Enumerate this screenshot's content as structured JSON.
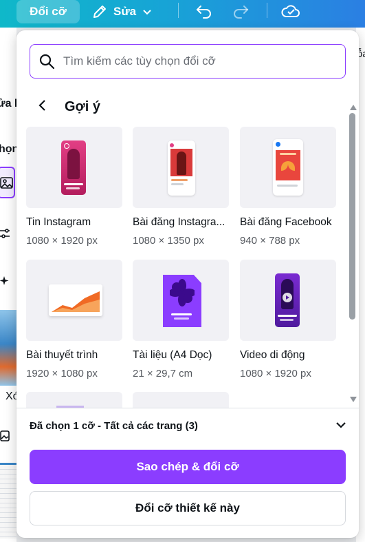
{
  "topbar": {
    "resize_label": "Đổi cỡ",
    "edit_label": "Sửa"
  },
  "background": {
    "left_snippets": [
      "ửa l",
      "họn",
      "Xó"
    ],
    "right_snippet": "ỗa"
  },
  "panel": {
    "search": {
      "placeholder": "Tìm kiếm các tùy chọn đổi cỡ"
    },
    "section_title": "Gợi ý",
    "cards": [
      {
        "label": "Tin Instagram",
        "dimensions": "1080 × 1920 px",
        "icon": "instagram-story-thumbnail"
      },
      {
        "label": "Bài đăng Instagra...",
        "dimensions": "1080 × 1350 px",
        "icon": "instagram-post-thumbnail"
      },
      {
        "label": "Bài đăng Facebook",
        "dimensions": "940 × 788 px",
        "icon": "facebook-post-thumbnail"
      },
      {
        "label": "Bài thuyết trình",
        "dimensions": "1920 × 1080 px",
        "icon": "presentation-thumbnail"
      },
      {
        "label": "Tài liệu (A4 Dọc)",
        "dimensions": "21 × 29,7 cm",
        "icon": "document-thumbnail"
      },
      {
        "label": "Video di động",
        "dimensions": "1080 × 1920 px",
        "icon": "mobile-video-thumbnail"
      }
    ],
    "selection_summary": "Đã chọn 1 cỡ - Tất cả các trang (3)",
    "primary_button": "Sao chép & đổi cỡ",
    "secondary_button": "Đổi cỡ thiết kế này"
  },
  "colors": {
    "accent": "#8b3dff",
    "topbar_start": "#0fb8c9",
    "topbar_end": "#2b7fe3"
  }
}
